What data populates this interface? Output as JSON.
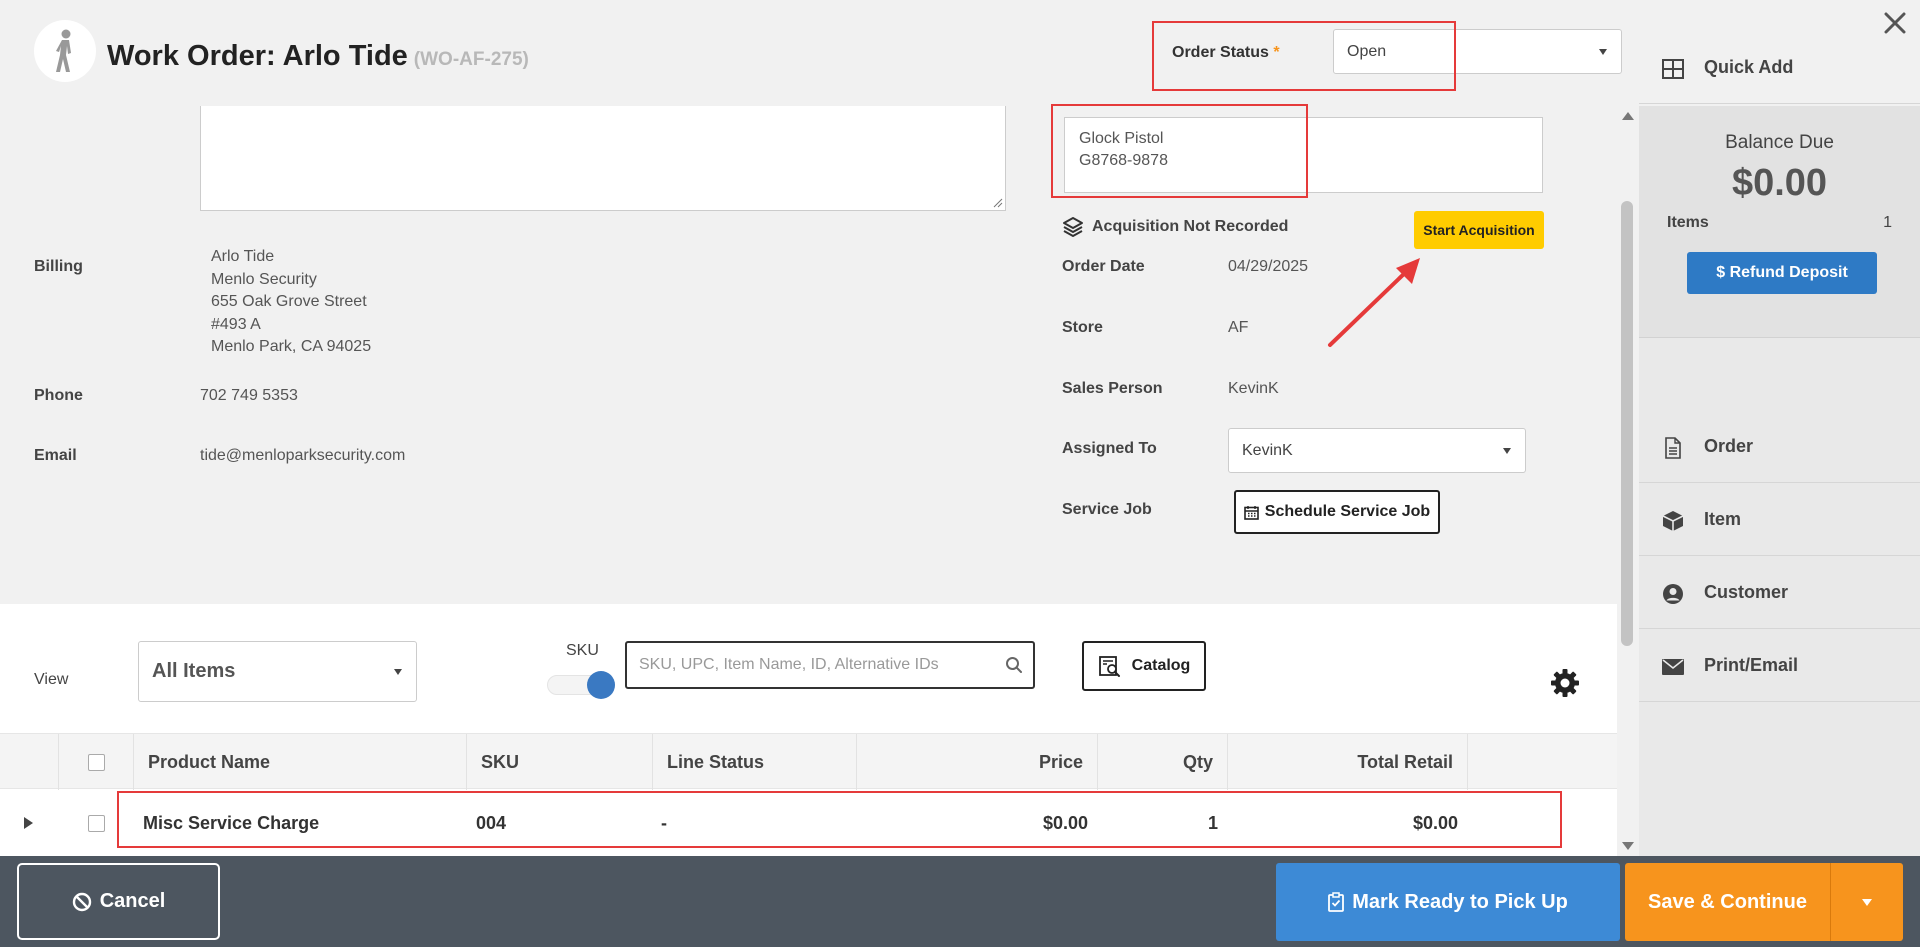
{
  "header": {
    "title": "Work Order: Arlo Tide",
    "order_id": "(WO-AF-275)",
    "order_status_label": "Order Status",
    "required_mark": "*",
    "order_status_value": "Open"
  },
  "item_box": {
    "line1": "Glock Pistol",
    "line2": "G8768-9878"
  },
  "acquisition": {
    "status_text": "Acquisition Not Recorded",
    "start_button": "Start Acquisition"
  },
  "customer": {
    "billing_label": "Billing",
    "billing_lines": [
      "Arlo Tide",
      "Menlo Security",
      "655 Oak Grove Street",
      "#493 A",
      "Menlo Park, CA 94025"
    ],
    "phone_label": "Phone",
    "phone": "702 749 5353",
    "email_label": "Email",
    "email": "tide@menloparksecurity.com"
  },
  "order_info": {
    "order_date_label": "Order Date",
    "order_date": "04/29/2025",
    "store_label": "Store",
    "store": "AF",
    "sales_person_label": "Sales Person",
    "sales_person": "KevinK",
    "assigned_to_label": "Assigned To",
    "assigned_to": "KevinK",
    "service_job_label": "Service Job",
    "schedule_button": "Schedule Service Job"
  },
  "toolbar": {
    "view_label": "View",
    "view_value": "All Items",
    "sku_label": "SKU",
    "sku_toggle_on": true,
    "search_placeholder": "SKU, UPC, Item Name, ID, Alternative IDs",
    "catalog_button": "Catalog"
  },
  "table": {
    "columns": [
      "Product Name",
      "SKU",
      "Line Status",
      "Price",
      "Qty",
      "Total Retail"
    ],
    "rows": [
      {
        "product_name": "Misc Service Charge",
        "sku": "004",
        "line_status": "-",
        "price": "$0.00",
        "qty": "1",
        "total_retail": "$0.00"
      }
    ]
  },
  "sidebar": {
    "balance_label": "Balance Due",
    "balance_amount": "$0.00",
    "items_label": "Items",
    "items_count": "1",
    "refund_button": "$ Refund Deposit",
    "menu": [
      {
        "label": "Quick Add",
        "icon": "grid-icon"
      },
      {
        "label": "Order",
        "icon": "document-icon"
      },
      {
        "label": "Item",
        "icon": "box-icon"
      },
      {
        "label": "Customer",
        "icon": "user-circle-icon"
      },
      {
        "label": "Print/Email",
        "icon": "envelope-icon"
      }
    ]
  },
  "footer": {
    "cancel_button": "Cancel",
    "ready_button": "Mark Ready to Pick Up",
    "save_button": "Save & Continue"
  },
  "colors": {
    "accent_orange": "#f7941d",
    "accent_blue": "#3d8ad6",
    "acquisition_yellow": "#ffcc00",
    "highlight_red": "#e53a3a",
    "footer_bg": "#4d5660"
  }
}
